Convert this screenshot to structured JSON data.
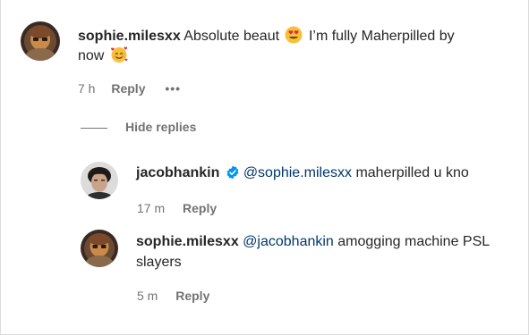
{
  "comment": {
    "username": "sophie.milesxx",
    "text_line1": "Absolute beaut",
    "text_line1_after": "I’m fully Maherpilled by",
    "text_line2": "now",
    "emoji1": "heart-eyes-emoji",
    "emoji2": "smiling-face-with-hearts-emoji",
    "time": "7 h",
    "reply_label": "Reply",
    "more_label": "•••"
  },
  "replies_toggle": {
    "label": "Hide replies"
  },
  "replies": [
    {
      "username": "jacobhankin",
      "verified": true,
      "mention": "@sophie.milesxx",
      "text": "maherpilled u kno",
      "time": "17 m",
      "reply_label": "Reply"
    },
    {
      "username": "sophie.milesxx",
      "mention": "@jacobhankin",
      "text_line1": "amogging machine PSL",
      "text_line2": "slayers",
      "time": "5 m",
      "reply_label": "Reply"
    }
  ],
  "colors": {
    "text": "#262626",
    "secondary": "#737373",
    "mention": "#00376b",
    "verified": "#0095f6"
  }
}
